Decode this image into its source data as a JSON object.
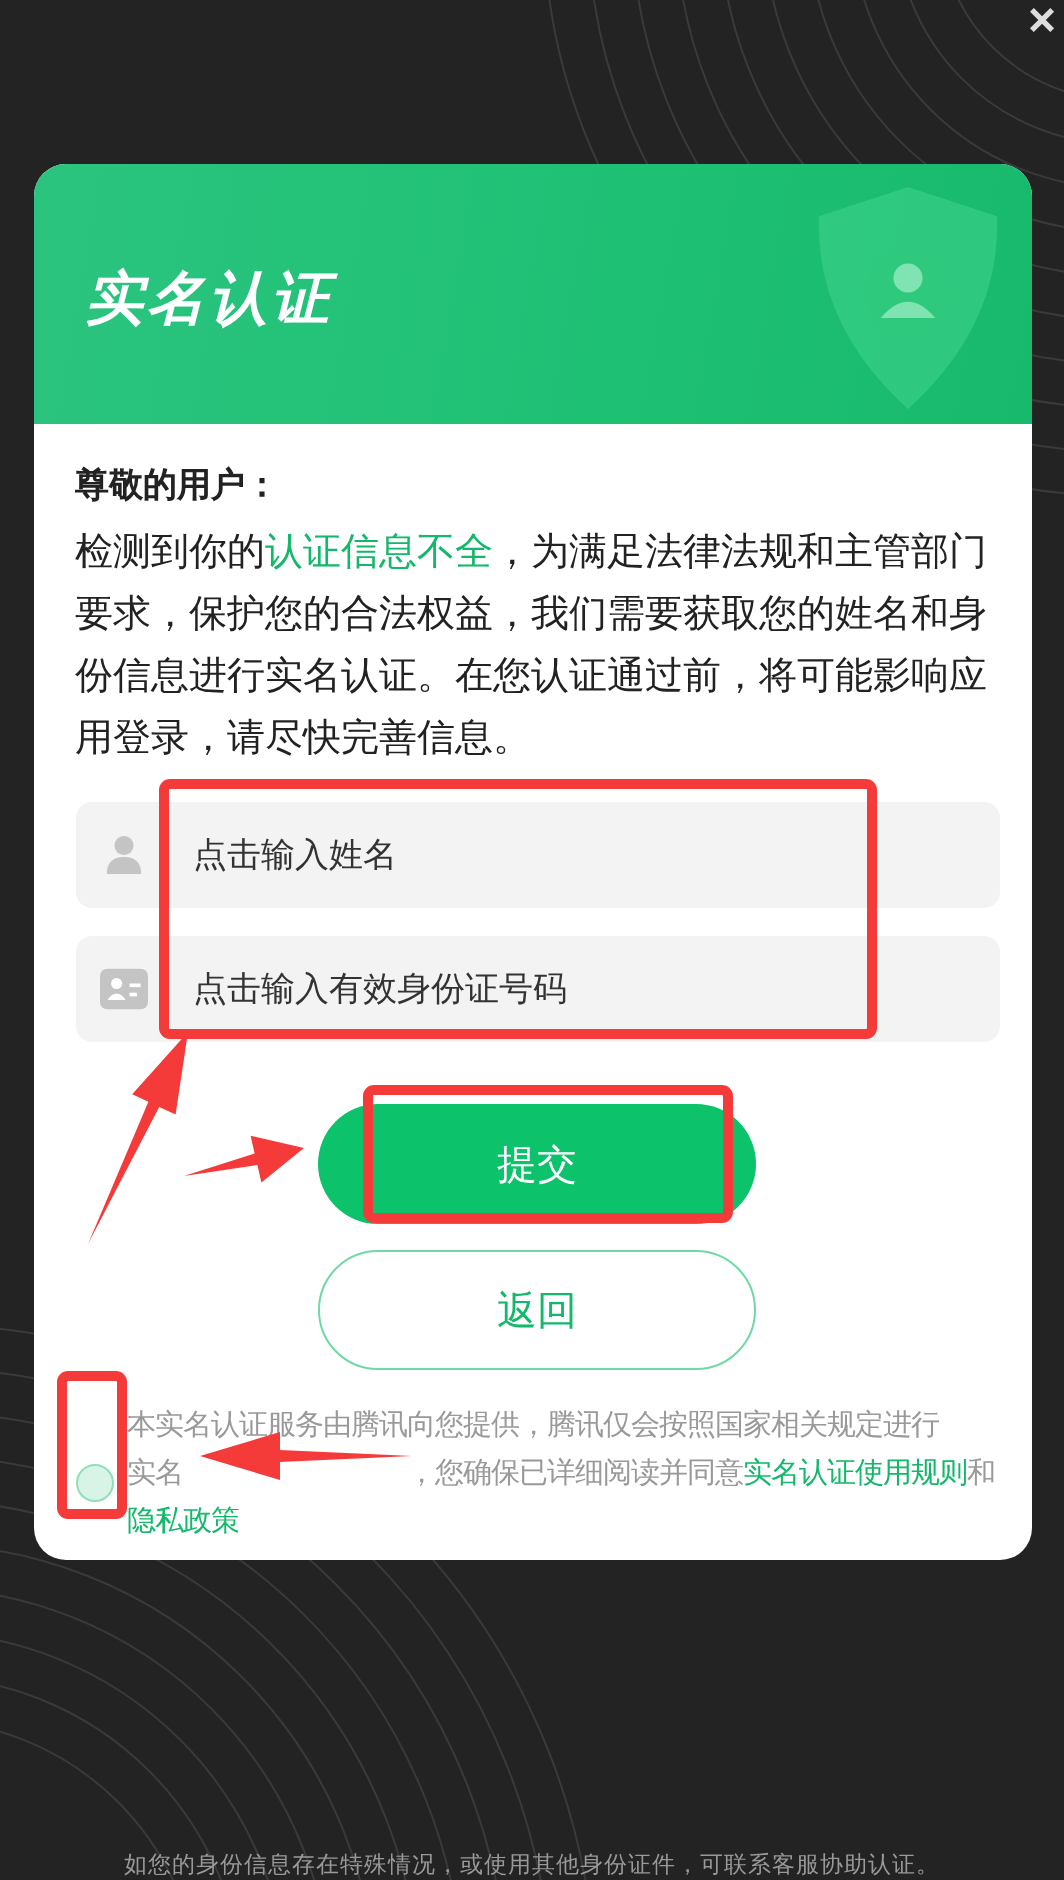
{
  "close_button": "×",
  "dialog": {
    "title": "实名认证",
    "greeting": "尊敬的用户：",
    "notice": [
      {
        "kind": "plain",
        "text": "检测到你的"
      },
      {
        "kind": "link",
        "text": "认证信息不全"
      },
      {
        "kind": "plain",
        "text": "，为满足法律法规和主管部门要求，保护您的合法权益，我们需要获取您的姓名和身份信息进行实名认证。在您认证通过前，将可能影响应用登录，请尽快完善信息。"
      }
    ],
    "fields": [
      {
        "kind": "name",
        "placeholder": "点击输入姓名"
      },
      {
        "kind": "id-card",
        "placeholder": "点击输入有效身份证号码"
      }
    ],
    "buttons": [
      {
        "kind": "primary",
        "label": "提交"
      },
      {
        "kind": "outline",
        "label": "返回"
      }
    ],
    "consent": {
      "checked": false,
      "lines": [
        [
          {
            "kind": "plain",
            "text": "本实名认证服务由腾讯向您提供，腾讯仅会按照国家相关规定进行"
          }
        ],
        [
          {
            "kind": "plain",
            "text": "实名"
          },
          {
            "kind": "hidden"
          },
          {
            "kind": "plain",
            "text": "，您确保已详细阅读并同意"
          },
          {
            "kind": "link",
            "text": "实名认证使用规则"
          },
          {
            "kind": "plain",
            "text": "和"
          }
        ],
        [
          {
            "kind": "link",
            "text": "隐私政策"
          }
        ]
      ]
    }
  },
  "footer_note": "如您的身份信息存在特殊情况，或使用其他身份证件，可联系客服协助认证。",
  "annotations": [
    {
      "kind": "box"
    },
    {
      "kind": "box"
    },
    {
      "kind": "box"
    },
    {
      "kind": "arrow"
    },
    {
      "kind": "arrow"
    },
    {
      "kind": "arrow"
    }
  ]
}
